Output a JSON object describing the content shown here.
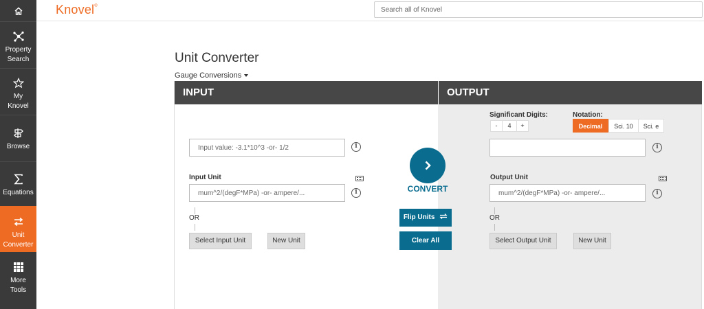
{
  "sidebar": {
    "items": [
      {
        "label_line1": "Property",
        "label_line2": "Search",
        "icon": "network-icon"
      },
      {
        "label_line1": "My",
        "label_line2": "Knovel",
        "icon": "star-icon"
      },
      {
        "label_line1": "Browse",
        "label_line2": "",
        "icon": "signpost-icon"
      },
      {
        "label_line1": "Equations",
        "label_line2": "",
        "icon": "sigma-icon"
      },
      {
        "label_line1": "Unit",
        "label_line2": "Converter",
        "icon": "swap-arrows-icon"
      },
      {
        "label_line1": "More",
        "label_line2": "Tools",
        "icon": "grid-icon"
      }
    ]
  },
  "header": {
    "logo": "Knovel",
    "logo_mark": "®",
    "search_placeholder": "Search all of Knovel"
  },
  "page": {
    "title": "Unit Converter",
    "gauge_label": "Gauge Conversions"
  },
  "input": {
    "header": "INPUT",
    "value_placeholder": "Input value: -3.1*10^3 -or- 1/2",
    "unit_label": "Input Unit",
    "unit_placeholder": "mum^2/(degF*MPa) -or- ampere/...",
    "or": "OR",
    "select_button": "Select Input Unit",
    "new_button": "New Unit"
  },
  "center": {
    "convert": "CONVERT",
    "flip": "Flip Units",
    "clear": "Clear All"
  },
  "output": {
    "header": "OUTPUT",
    "sig_label": "Significant Digits:",
    "sig_minus": "-",
    "sig_value": "4",
    "sig_plus": "+",
    "notation_label": "Notation:",
    "notation_options": [
      "Decimal",
      "Sci. 10",
      "Sci. e"
    ],
    "notation_selected": "Decimal",
    "value": "",
    "unit_label": "Output Unit",
    "unit_placeholder": "mum^2/(degF*MPa) -or- ampere/...",
    "or": "OR",
    "select_button": "Select Output Unit",
    "new_button": "New Unit"
  },
  "colors": {
    "accent": "#ee6b24",
    "primary": "#0a6d8f",
    "sidebar": "#3a3a3a",
    "header": "#474747"
  }
}
